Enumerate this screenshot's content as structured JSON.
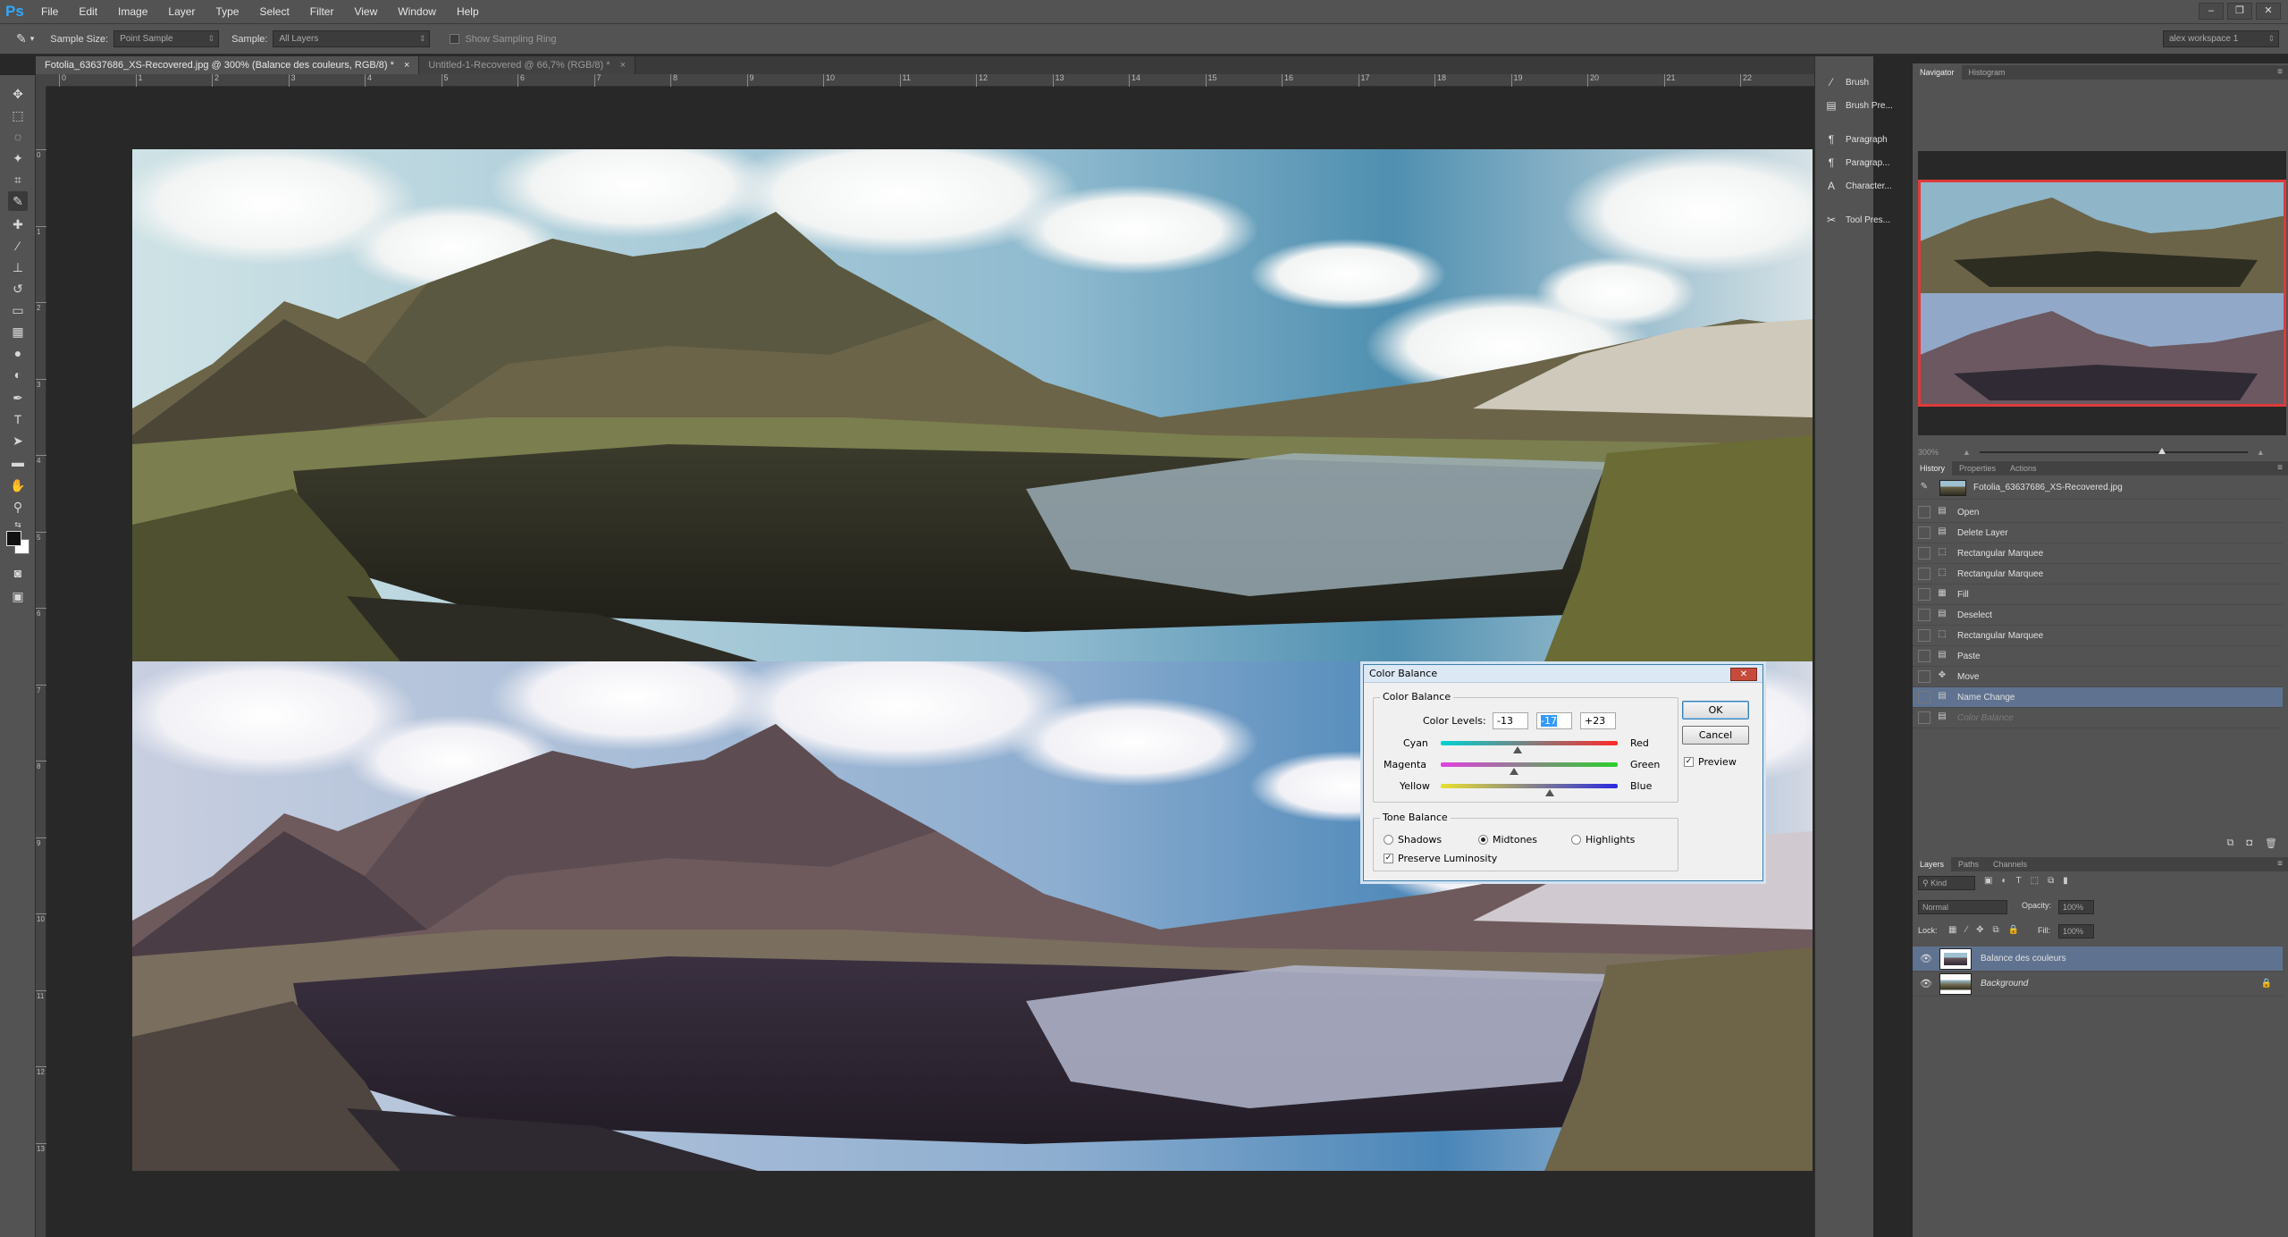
{
  "app": {
    "logo": "Ps"
  },
  "menu": [
    "File",
    "Edit",
    "Image",
    "Layer",
    "Type",
    "Select",
    "Filter",
    "View",
    "Window",
    "Help"
  ],
  "window_controls": [
    "–",
    "❐",
    "✕"
  ],
  "options": {
    "sample_size_label": "Sample Size:",
    "sample_size_value": "Point Sample",
    "sample_label": "Sample:",
    "sample_value": "All Layers",
    "sampling_ring_label": "Show Sampling Ring",
    "workspace": "alex workspace 1"
  },
  "tabs": [
    {
      "label": "Fotolia_63637686_XS-Recovered.jpg @ 300% (Balance des couleurs, RGB/8) *",
      "close": "×"
    },
    {
      "label": "Untitled-1-Recovered @ 66,7% (RGB/8) *",
      "close": "×"
    }
  ],
  "ruler_h": [
    "0",
    "1",
    "2",
    "3",
    "4",
    "5",
    "6",
    "7",
    "8",
    "9",
    "10",
    "11",
    "12",
    "13",
    "14",
    "15",
    "16",
    "17",
    "18",
    "19",
    "20",
    "21",
    "22"
  ],
  "ruler_v": [
    "0",
    "1",
    "2",
    "3",
    "4",
    "5",
    "6",
    "7",
    "8",
    "9",
    "10",
    "11",
    "12",
    "13"
  ],
  "icon_panel": [
    "Brush",
    "Brush Pre...",
    "Paragraph",
    "Paragrap...",
    "Character...",
    "Tool Pres..."
  ],
  "navigator": {
    "tabs": [
      "Navigator",
      "Histogram"
    ],
    "zoom": "300%"
  },
  "history": {
    "tabs": [
      "History",
      "Properties",
      "Actions"
    ],
    "snapshot": "Fotolia_63637686_XS-Recovered.jpg",
    "items": [
      "Open",
      "Delete Layer",
      "Rectangular Marquee",
      "Rectangular Marquee",
      "Fill",
      "Deselect",
      "Rectangular Marquee",
      "Paste",
      "Move",
      "Name Change",
      "Color Balance"
    ]
  },
  "layers": {
    "tabs": [
      "Layers",
      "Paths",
      "Channels"
    ],
    "kind": "Kind",
    "blend_mode": "Normal",
    "opacity_label": "Opacity:",
    "opacity_value": "100%",
    "lock_label": "Lock:",
    "fill_label": "Fill:",
    "fill_value": "100%",
    "items": [
      {
        "name": "Balance des couleurs",
        "active": true
      },
      {
        "name": "Background",
        "active": false
      }
    ]
  },
  "dialog": {
    "title": "Color Balance",
    "close": "✕",
    "group1": "Color Balance",
    "levels_label": "Color Levels:",
    "levels": [
      "-13",
      "-17",
      "+23"
    ],
    "sliders": [
      {
        "left": "Cyan",
        "right": "Red",
        "value": -13
      },
      {
        "left": "Magenta",
        "right": "Green",
        "value": -17
      },
      {
        "left": "Yellow",
        "right": "Blue",
        "value": 23
      }
    ],
    "group2": "Tone Balance",
    "tones": [
      "Shadows",
      "Midtones",
      "Highlights"
    ],
    "selected_tone": "Midtones",
    "preserve": "Preserve Luminosity",
    "ok": "OK",
    "cancel": "Cancel",
    "preview": "Preview"
  }
}
